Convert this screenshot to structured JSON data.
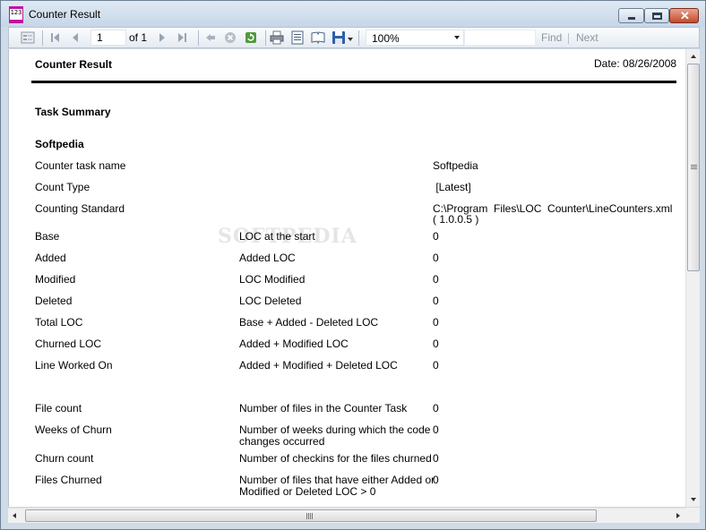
{
  "window": {
    "title": "Counter Result",
    "app_icon_text": "123"
  },
  "toolbar": {
    "page_current": "1",
    "page_of_label": "of 1",
    "zoom": "100%",
    "find_label": "Find",
    "next_label": "Next"
  },
  "report": {
    "title": "Counter Result",
    "date": "Date: 08/26/2008",
    "section_title": "Task Summary",
    "task_name_heading": "Softpedia",
    "rows": [
      {
        "label": "Counter task name",
        "desc": "",
        "value": "Softpedia"
      },
      {
        "label": "Count Type",
        "desc": "",
        "value": " [Latest]"
      },
      {
        "label": "Counting Standard",
        "desc": "",
        "value": "C:\\Program  Files\\LOC  Counter\\LineCounters.xml",
        "value2": "( 1.0.0.5 )"
      },
      {
        "label": "Base",
        "desc": "LOC at the start",
        "value": "0"
      },
      {
        "label": "Added",
        "desc": "Added LOC",
        "value": "0"
      },
      {
        "label": "Modified",
        "desc": "LOC Modified",
        "value": "0"
      },
      {
        "label": "Deleted",
        "desc": "LOC Deleted",
        "value": "0"
      },
      {
        "label": "Total LOC",
        "desc": "Base + Added - Deleted LOC",
        "value": "0"
      },
      {
        "label": "Churned LOC",
        "desc": "Added + Modified LOC",
        "value": "0"
      },
      {
        "label": "Line Worked On",
        "desc": "Added + Modified + Deleted LOC",
        "value": "0"
      },
      {
        "label": "File count",
        "desc": "Number of files in the Counter Task",
        "value": "0"
      },
      {
        "label": "Weeks of Churn",
        "desc": "Number of weeks during which the code",
        "desc2": "changes occurred",
        "value": "0"
      },
      {
        "label": "Churn count",
        "desc": "Number of checkins for the files churned",
        "value": "0"
      },
      {
        "label": "Files Churned",
        "desc": "Number of files that have either Added or",
        "desc2": "Modified or Deleted LOC > 0",
        "value": "0"
      }
    ],
    "watermark": "SOFTPEDIA"
  },
  "colors": {
    "accent": "#c0149e",
    "close_button": "#c54a2b",
    "frame": "#cfdbe7"
  },
  "icons": [
    "app-icon",
    "toggle-parameters-icon",
    "first-page-icon",
    "previous-page-icon",
    "next-page-icon",
    "last-page-icon",
    "back-icon",
    "stop-icon",
    "refresh-icon",
    "print-icon",
    "print-layout-icon",
    "page-setup-icon",
    "save-icon"
  ]
}
